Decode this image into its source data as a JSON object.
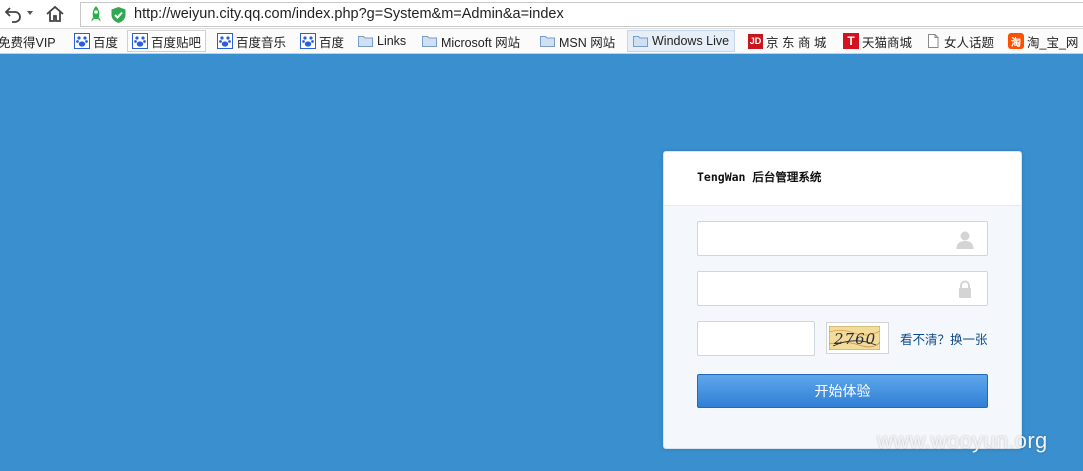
{
  "browser": {
    "url": "http://weiyun.city.qq.com/index.php?g=System&m=Admin&a=index",
    "bookmarks": [
      {
        "label": "免费得VIP",
        "icon": "none"
      },
      {
        "label": "百度",
        "icon": "baidu-paw-icon"
      },
      {
        "label": "百度贴吧",
        "icon": "baidu-paw-icon"
      },
      {
        "label": "百度音乐",
        "icon": "baidu-paw-icon"
      },
      {
        "label": "百度",
        "icon": "baidu-paw-icon"
      },
      {
        "label": "Links",
        "icon": "folder-icon"
      },
      {
        "label": "Microsoft 网站",
        "icon": "folder-icon"
      },
      {
        "label": "MSN 网站",
        "icon": "folder-icon"
      },
      {
        "label": "Windows Live",
        "icon": "folder-icon"
      },
      {
        "label": "京 东 商 城",
        "icon": "jd-icon"
      },
      {
        "label": "天猫商城",
        "icon": "tmall-icon"
      },
      {
        "label": "女人话题",
        "icon": "page-icon"
      },
      {
        "label": "淘_宝_网",
        "icon": "taobao-icon"
      }
    ],
    "icons": {
      "jd": "JD",
      "tmall": "T",
      "taobao": "淘"
    }
  },
  "login": {
    "title": "TengWan 后台管理系统",
    "username_placeholder": "",
    "password_placeholder": "",
    "captcha_placeholder": "",
    "captcha_text": "2760",
    "refresh_link": "看不清？换一张",
    "submit_label": "开始体验"
  },
  "watermark": "www.wooyun.org",
  "colors": {
    "background": "#3a8fcf",
    "button": "#3d8ddd",
    "link": "#0e4a8a"
  }
}
